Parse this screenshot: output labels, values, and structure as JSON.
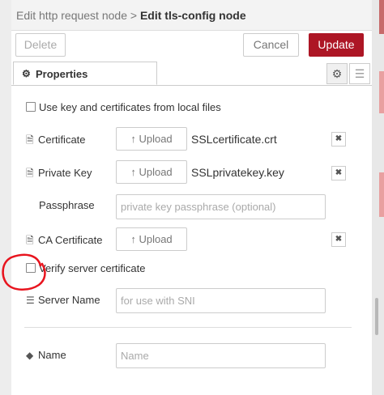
{
  "breadcrumb": {
    "previous": "Edit http request node",
    "separator": " > ",
    "current": "Edit tls-config node"
  },
  "toolbar": {
    "delete_label": "Delete",
    "cancel_label": "Cancel",
    "update_label": "Update"
  },
  "tabs": {
    "properties_icon": "⚙",
    "properties_label": "Properties",
    "gear_icon": "⚙",
    "doc_icon": "☰"
  },
  "form": {
    "local_files_label": "Use key and certificates from local files",
    "certificate_label": "Certificate",
    "certificate_file": "SSLcertificate.crt",
    "private_key_label": "Private Key",
    "private_key_file": "SSLprivatekey.key",
    "passphrase_label": "Passphrase",
    "passphrase_placeholder": "private key passphrase (optional)",
    "ca_certificate_label": "CA Certificate",
    "upload_label": "Upload",
    "upload_icon": "↑",
    "remove_icon": "✖",
    "verify_label": "Verify server certificate",
    "server_name_label": "Server Name",
    "server_name_placeholder": "for use with SNI",
    "name_label": "Name",
    "name_placeholder": "Name"
  },
  "icons": {
    "file": "🗎",
    "server": "☰",
    "tag": "◆"
  },
  "colors": {
    "update_button": "#ad1625",
    "annotation": "#e8141e"
  }
}
